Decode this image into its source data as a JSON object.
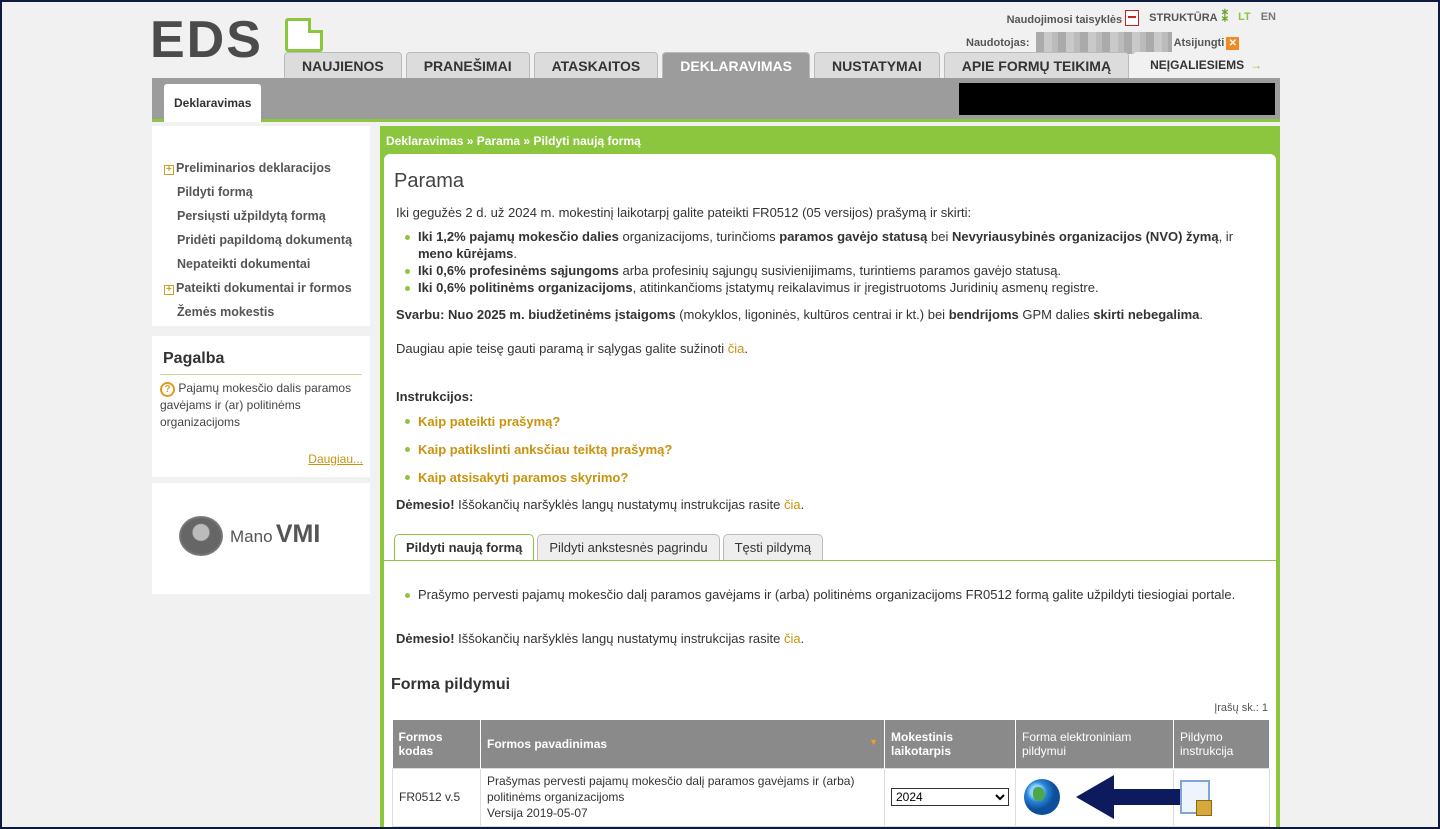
{
  "header": {
    "logo_text": "EDS",
    "top_links": {
      "rules": "Naudojimosi taisyklės",
      "structure": "STRUKTŪRA",
      "lang_lt": "LT",
      "lang_en": "EN"
    },
    "user_label": "Naudotojas:",
    "logout": "Atsijungti"
  },
  "tabs": [
    {
      "label": "NAUJIENOS"
    },
    {
      "label": "PRANEŠIMAI"
    },
    {
      "label": "ATASKAITOS"
    },
    {
      "label": "DEKLARAVIMAS"
    },
    {
      "label": "NUSTATYMAI"
    },
    {
      "label": "APIE FORMŲ TEIKIMĄ"
    },
    {
      "label": "NEĮGALIESIEMS"
    }
  ],
  "subtab": "Deklaravimas",
  "sidebar": {
    "items": [
      {
        "label": "Preliminarios deklaracijos"
      },
      {
        "label": "Pildyti formą"
      },
      {
        "label": "Persiųsti užpildytą formą"
      },
      {
        "label": "Pridėti papildomą dokumentą"
      },
      {
        "label": "Nepateikti dokumentai"
      },
      {
        "label": "Pateikti dokumentai ir formos"
      },
      {
        "label": "Žemės mokestis"
      }
    ],
    "help": {
      "title": "Pagalba",
      "text": "Pajamų mokesčio dalis paramos gavėjams ir (ar) politinėms organizacijoms",
      "more": "Daugiau..."
    },
    "vmi": {
      "mano": "Mano",
      "vmi": "VMI"
    }
  },
  "main": {
    "breadcrumb": "Deklaravimas » Parama » Pildyti naują formą",
    "title": "Parama",
    "intro": "Iki gegužės 2 d. už 2024 m. mokestinį laikotarpį galite pateikti FR0512 (05 versijos) prašymą ir skirti:",
    "bullets": [
      {
        "b1": "Iki 1,2% pajamų mokesčio dalies",
        "t1": " organizacijoms, turinčioms ",
        "b2": "paramos gavėjo statusą",
        "t2": " bei ",
        "b3": "Nevyriausybinės organizacijos (NVO) žymą",
        "t3": ", ir ",
        "b4": "meno kūrėjams",
        "t4": "."
      },
      {
        "b1": "Iki 0,6% profesinėms sąjungoms",
        "t1": " arba profesinių sąjungų susivienijimams, turintiems paramos gavėjo statusą."
      },
      {
        "b1": "Iki 0,6% politinėms organizacijoms",
        "t1": ", atitinkančioms įstatymų reikalavimus ir įregistruotoms Juridinių asmenų registre."
      }
    ],
    "important": {
      "b1": "Svarbu: Nuo 2025 m. biudžetinėms įstaigoms",
      "t1": " (mokyklos, ligoninės, kultūros centrai ir kt.) bei ",
      "b2": "bendrijoms",
      "t2": " GPM dalies ",
      "b3": "skirti nebegalima",
      "t3": "."
    },
    "more_text": "Daugiau apie teisę gauti paramą ir sąlygas galite sužinoti ",
    "more_link": "čia",
    "instructions_title": "Instrukcijos:",
    "instructions": [
      {
        "label": "Kaip pateikti prašymą?"
      },
      {
        "label": "Kaip patikslinti anksčiau teiktą prašymą?"
      },
      {
        "label": "Kaip atsisakyti paramos skyrimo?"
      }
    ],
    "attention_bold": "Dėmesio!",
    "attention_text": " Iššokančių naršyklės langų nustatymų instrukcijas rasite ",
    "attention_link": "čia",
    "inner_tabs": [
      {
        "label": "Pildyti naują formą"
      },
      {
        "label": "Pildyti ankstesnės pagrindu"
      },
      {
        "label": "Tęsti pildymą"
      }
    ],
    "tab_bullet": "Prašymo pervesti pajamų mokesčio dalį paramos gavėjams ir (arba) politinėms organizacijoms FR0512 formą galite užpildyti tiesiogiai portale.",
    "form_title": "Forma pildymui",
    "count": "Įrašų sk.: 1",
    "table": {
      "headers": [
        "Formos kodas",
        "Formos pavadinimas",
        "Mokestinis laikotarpis",
        "Forma elektroniniam pildymui",
        "Pildymo instrukcija"
      ],
      "rows": [
        {
          "code": "FR0512 v.5",
          "name": "Prašymas pervesti pajamų mokesčio dalį paramos gavėjams ir (arba) politinėms organizacijoms",
          "version": "Versija 2019-05-07",
          "period": "2024"
        }
      ]
    }
  },
  "colors": {
    "accent_green": "#8cc63f",
    "link_orange": "#c8930e",
    "arrow_navy": "#0d1b5e"
  },
  "icons": [
    "pdf-icon",
    "structure-tree-icon",
    "close-x-icon",
    "plus-box-icon",
    "question-icon",
    "vmi-logo-icon",
    "globe-icon",
    "arrow-left-icon",
    "document-icon",
    "sort-arrow-icon"
  ]
}
